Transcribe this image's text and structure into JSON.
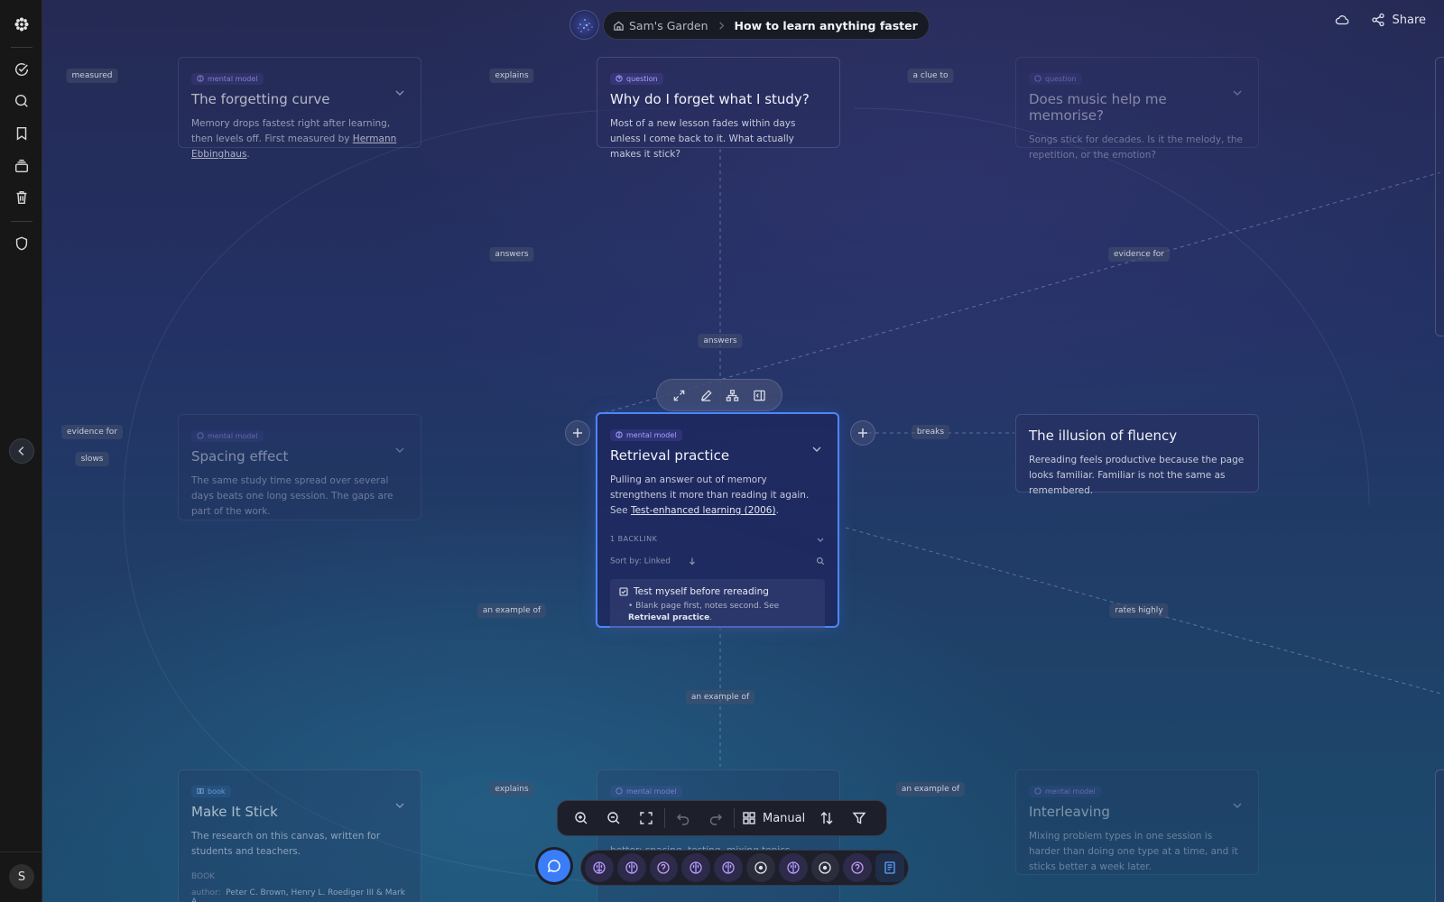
{
  "sidebar": {
    "avatar_initial": "S",
    "icons": [
      "app-logo-icon",
      "check-circle-icon",
      "search-icon",
      "bookmark-icon",
      "stack-icon",
      "trash-icon",
      "shield-icon",
      "chevron-left-icon"
    ]
  },
  "topbar": {
    "breadcrumb_home": "Sam's Garden",
    "breadcrumb_current": "How to learn anything faster",
    "share_label": "Share"
  },
  "edge_labels": {
    "measured": "measured",
    "explains_top": "explains",
    "a_clue_to": "a clue to",
    "answers_left": "answers",
    "evidence_for_right": "evidence for",
    "answers_center": "answers",
    "evidence_for_left": "evidence for",
    "slows": "slows",
    "breaks": "breaks",
    "an_example_of_left": "an example of",
    "rates_highly": "rates highly",
    "an_example_of_center": "an example of",
    "explains_bottom": "explains",
    "an_example_of_right": "an example of"
  },
  "cards": {
    "forgetting": {
      "tag": "mental model",
      "title": "The forgetting curve",
      "body": "Memory drops fastest right after learning, then levels off. First measured by ",
      "link": "Hermann Ebbinghaus",
      "tail": "."
    },
    "why_forget": {
      "tag": "question",
      "title": "Why do I forget what I study?",
      "body": "Most of a new lesson fades within days unless I come back to it. What actually makes it stick?"
    },
    "music": {
      "tag": "question",
      "title": "Does music help me memorise?",
      "body": "Songs stick for decades. Is it the melody, the repetition, or the emotion?"
    },
    "spacing": {
      "tag": "mental model",
      "title": "Spacing effect",
      "body": "The same study time spread over several days beats one long session. The gaps are part of the work."
    },
    "retrieval": {
      "tag": "mental model",
      "title": "Retrieval practice",
      "body": "Pulling an answer out of memory strengthens it more than reading it again. See ",
      "link": "Test-enhanced learning (2006)",
      "tail": ".",
      "backlink_count": "1 BACKLINK",
      "sort_by": "Sort by: Linked",
      "backlink_title": "Test myself before rereading",
      "backlink_snippet": "Blank page first, notes second. See ",
      "backlink_snippet_bold": "Retrieval practice",
      "backlink_snippet_tail": "."
    },
    "fluency": {
      "title": "The illusion of fluency",
      "body": "Rereading feels productive because the page looks familiar. Familiar is not the same as remembered."
    },
    "make_it_stick": {
      "tag": "book",
      "title": "Make It Stick",
      "body": "The research on this canvas, written for students and teachers.",
      "meta_label": "BOOK",
      "author_label": "author:",
      "author_value": "Peter C. Brown, Henry L. Roediger III & Mark A. ..."
    },
    "bottom_center": {
      "tag": "mental model",
      "body": "better: spacing, testing, mixing topics. Named by"
    },
    "interleaving": {
      "tag": "mental model",
      "title": "Interleaving",
      "body": "Mixing problem types in one session is harder than doing one type at a time, and it sticks better a week later."
    }
  },
  "card_toolbar": [
    "expand-icon",
    "edit-icon",
    "hierarchy-icon",
    "side-panel-icon"
  ],
  "bottom_toolbar": {
    "layout_label": "Manual"
  },
  "node_strip": [
    "brain",
    "brain",
    "question",
    "brain",
    "brain",
    "circle",
    "brain",
    "circle",
    "question",
    "book"
  ],
  "colors": {
    "accent": "#3b7df6",
    "selection": "#4f86f7",
    "tag_mental_model": "#a9a0ff",
    "tag_book": "#8fc0ff"
  }
}
